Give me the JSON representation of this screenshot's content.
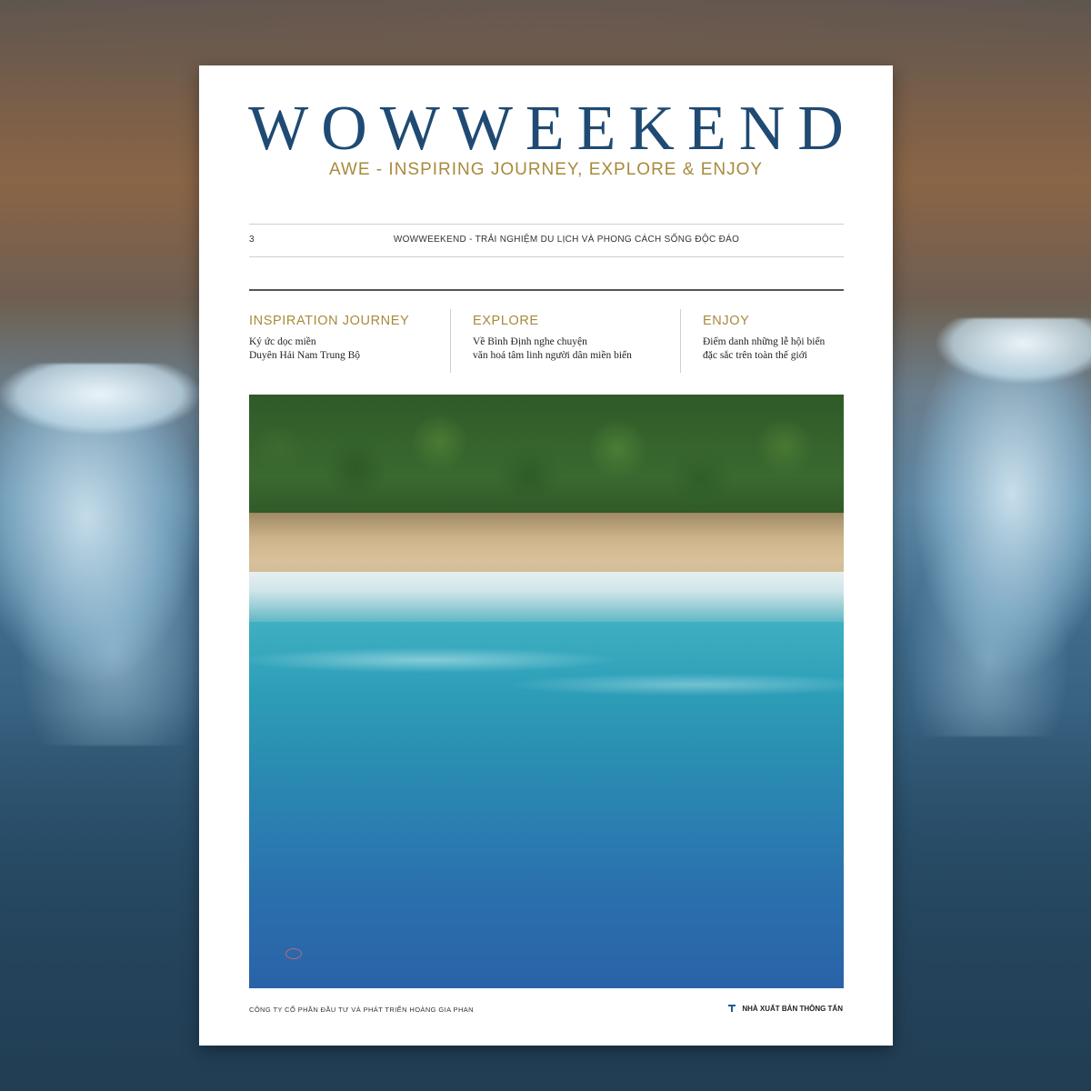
{
  "masthead": {
    "title": "WOWWEEKEND",
    "tagline": "AWE - INSPIRING JOURNEY, EXPLORE & ENJOY"
  },
  "issue": {
    "number": "3",
    "line": "WOWWEEKEND - TRẢI NGHIỆM DU LỊCH VÀ PHONG CÁCH SỐNG ĐỘC ĐÁO"
  },
  "sections": [
    {
      "title": "INSPIRATION JOURNEY",
      "line1": "Ký ức dọc miền",
      "line2": "Duyên Hải Nam Trung Bộ"
    },
    {
      "title": "EXPLORE",
      "line1": "Về Bình Định nghe chuyện",
      "line2": "văn hoá tâm linh người dân miền biển"
    },
    {
      "title": "ENJOY",
      "line1": "Điểm danh những lễ hội biển",
      "line2": "đặc sắc trên toàn thế giới"
    }
  ],
  "footer": {
    "company": "CÔNG TY CỔ PHẦN ĐẦU TƯ VÀ PHÁT TRIỂN HOÀNG GIA PHAN",
    "publisher": "NHÀ XUẤT BẢN THÔNG TẤN"
  },
  "logo_text": "Wowweekend",
  "colors": {
    "masthead": "#1f4a73",
    "accent_gold": "#a88a3c",
    "page": "#ffffff"
  }
}
